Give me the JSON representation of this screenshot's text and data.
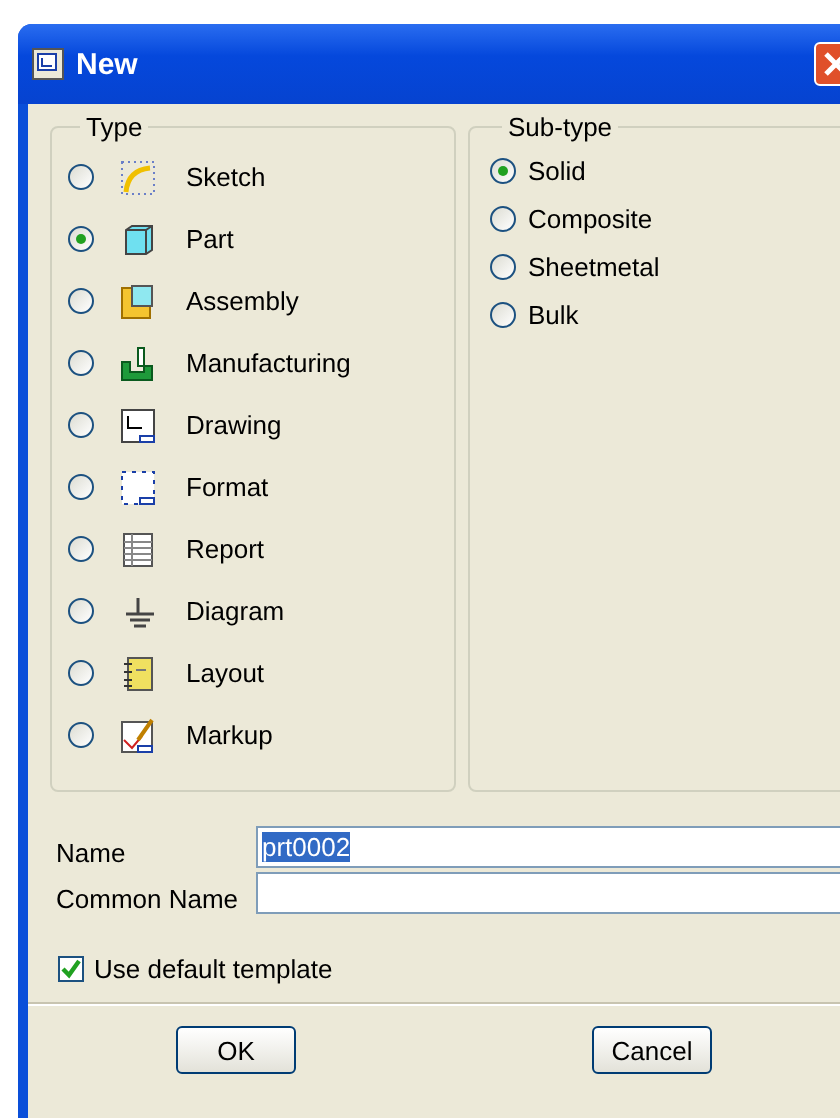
{
  "window": {
    "title": "New"
  },
  "type_group": {
    "label": "Type",
    "options": [
      {
        "label": "Sketch",
        "selected": false
      },
      {
        "label": "Part",
        "selected": true
      },
      {
        "label": "Assembly",
        "selected": false
      },
      {
        "label": "Manufacturing",
        "selected": false
      },
      {
        "label": "Drawing",
        "selected": false
      },
      {
        "label": "Format",
        "selected": false
      },
      {
        "label": "Report",
        "selected": false
      },
      {
        "label": "Diagram",
        "selected": false
      },
      {
        "label": "Layout",
        "selected": false
      },
      {
        "label": "Markup",
        "selected": false
      }
    ]
  },
  "subtype_group": {
    "label": "Sub-type",
    "options": [
      {
        "label": "Solid",
        "selected": true
      },
      {
        "label": "Composite",
        "selected": false
      },
      {
        "label": "Sheetmetal",
        "selected": false
      },
      {
        "label": "Bulk",
        "selected": false
      }
    ]
  },
  "fields": [
    {
      "label": "Name",
      "value": "prt0002",
      "selected": true
    },
    {
      "label": "Common Name"
    }
  ],
  "use_default_template": {
    "label": "Use default template",
    "checked": true
  },
  "buttons": [
    "OK",
    "Cancel"
  ]
}
